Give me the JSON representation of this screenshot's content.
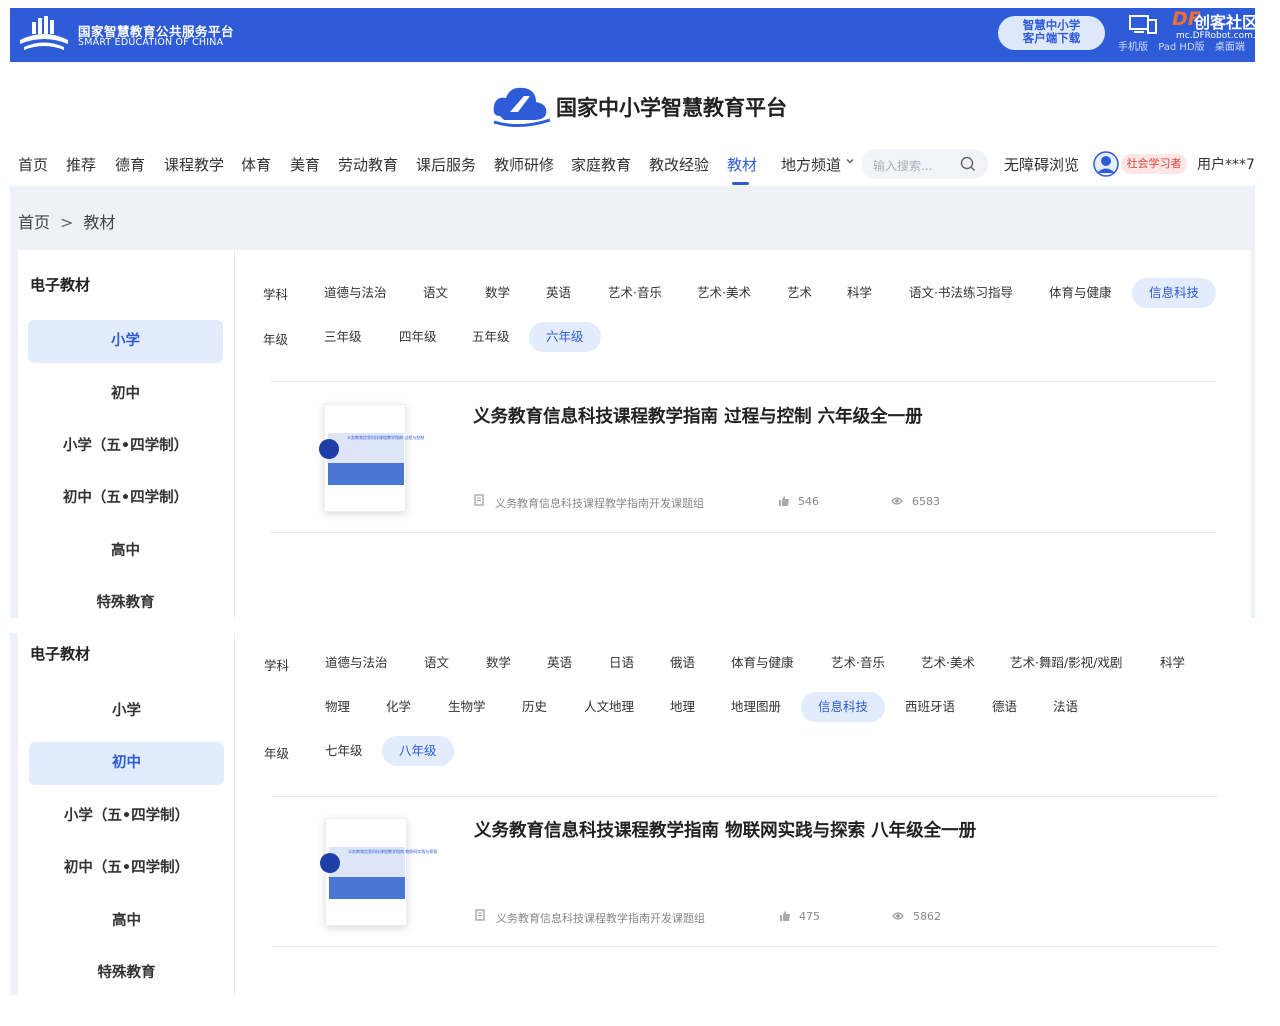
{
  "topbar": {
    "logo_cn": "国家智慧教育公共服务平台",
    "logo_en": "SMART EDUCATION OF CHINA",
    "download_line1": "智慧中小学",
    "download_line2": "客户端下载",
    "devices": [
      "手机版",
      "Pad HD版",
      "桌面端"
    ],
    "watermark_df": "DF",
    "watermark_text": "创客社区",
    "watermark_url": "mc.DFRobot.com.cn"
  },
  "header": {
    "brand": "国家中小学智慧教育平台"
  },
  "nav": {
    "items": [
      "首页",
      "推荐",
      "德育",
      "课程教学",
      "体育",
      "美育",
      "劳动教育",
      "课后服务",
      "教师研修",
      "家庭教育",
      "教改经验",
      "教材",
      "地方频道"
    ],
    "active": "教材",
    "search_placeholder": "输入搜索...",
    "accessibility": "无障碍浏览",
    "role": "社会学习者",
    "user": "用户***7"
  },
  "breadcrumb": {
    "home": "首页",
    "sep": ">",
    "current": "教材"
  },
  "panel1": {
    "side_title": "电子教材",
    "side_items": [
      "小学",
      "初中",
      "小学（五•四学制）",
      "初中（五•四学制）",
      "高中",
      "特殊教育"
    ],
    "side_active": "小学",
    "subject_label": "学科",
    "subjects": [
      "道德与法治",
      "语文",
      "数学",
      "英语",
      "艺术·音乐",
      "艺术·美术",
      "艺术",
      "科学",
      "语文·书法练习指导",
      "体育与健康",
      "信息科技"
    ],
    "subject_active": "信息科技",
    "grade_label": "年级",
    "grades": [
      "三年级",
      "四年级",
      "五年级",
      "六年级"
    ],
    "grade_active": "六年级",
    "book": {
      "title": "义务教育信息科技课程教学指南 过程与控制 六年级全一册",
      "author": "义务教育信息科技课程教学指南开发课题组",
      "likes": "546",
      "views": "6583",
      "cover_text": "义务教育信息科技课程教学指南 过程与控制"
    }
  },
  "panel2": {
    "side_title": "电子教材",
    "side_items": [
      "小学",
      "初中",
      "小学（五•四学制）",
      "初中（五•四学制）",
      "高中",
      "特殊教育"
    ],
    "side_active": "初中",
    "subject_label": "学科",
    "subjects_row1": [
      "道德与法治",
      "语文",
      "数学",
      "英语",
      "日语",
      "俄语",
      "体育与健康",
      "艺术·音乐",
      "艺术·美术",
      "艺术·舞蹈/影视/戏剧",
      "科学"
    ],
    "subjects_row2": [
      "物理",
      "化学",
      "生物学",
      "历史",
      "人文地理",
      "地理",
      "地理图册",
      "信息科技",
      "西班牙语",
      "德语",
      "法语"
    ],
    "subject_active": "信息科技",
    "grade_label": "年级",
    "grades": [
      "七年级",
      "八年级"
    ],
    "grade_active": "八年级",
    "book": {
      "title": "义务教育信息科技课程教学指南 物联网实践与探索 八年级全一册",
      "author": "义务教育信息科技课程教学指南开发课题组",
      "likes": "475",
      "views": "5862",
      "cover_text": "义务教育信息科技课程教学指南 物联网实践与探索"
    }
  },
  "colors": {
    "brand": "#2e5bd8",
    "active_bg": "#e3ecfc",
    "role_badge": "#e0433b"
  }
}
